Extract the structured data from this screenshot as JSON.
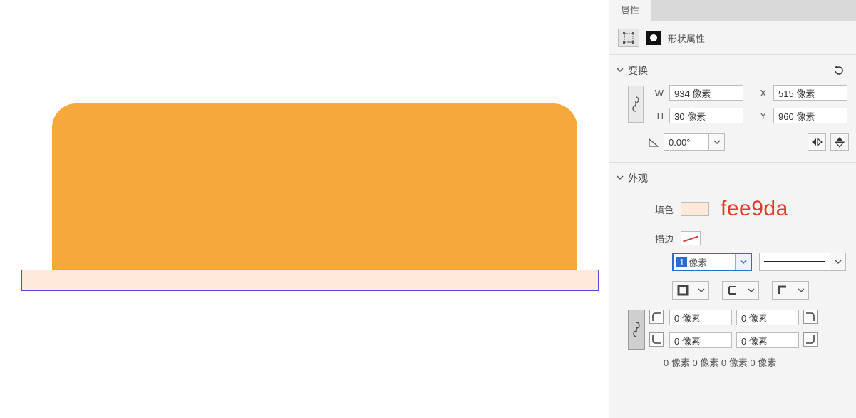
{
  "panel": {
    "tab_properties": "属性",
    "shape_properties_label": "形状属性"
  },
  "transform": {
    "section_title": "变换",
    "w_label": "W",
    "w_value": "934 像素",
    "x_label": "X",
    "x_value": "515 像素",
    "h_label": "H",
    "h_value": "30 像素",
    "y_label": "Y",
    "y_value": "960 像素",
    "rotation": "0.00°"
  },
  "appearance": {
    "section_title": "外观",
    "fill_label": "填色",
    "fill_hex_annotation": "fee9da",
    "stroke_label": "描边",
    "stroke_width_selected": "1",
    "stroke_width_unit": "像素",
    "corner_tl": "0 像素",
    "corner_tr": "0 像素",
    "corner_bl": "0 像素",
    "corner_br": "0 像素",
    "corner_summary": "0 像素 0 像素 0 像素 0 像素"
  },
  "colors": {
    "shape_orange": "#f6a93b",
    "shape_fill": "#fee9da",
    "selection_border": "#4a4af0",
    "annotation_red": "#e33a2f"
  }
}
